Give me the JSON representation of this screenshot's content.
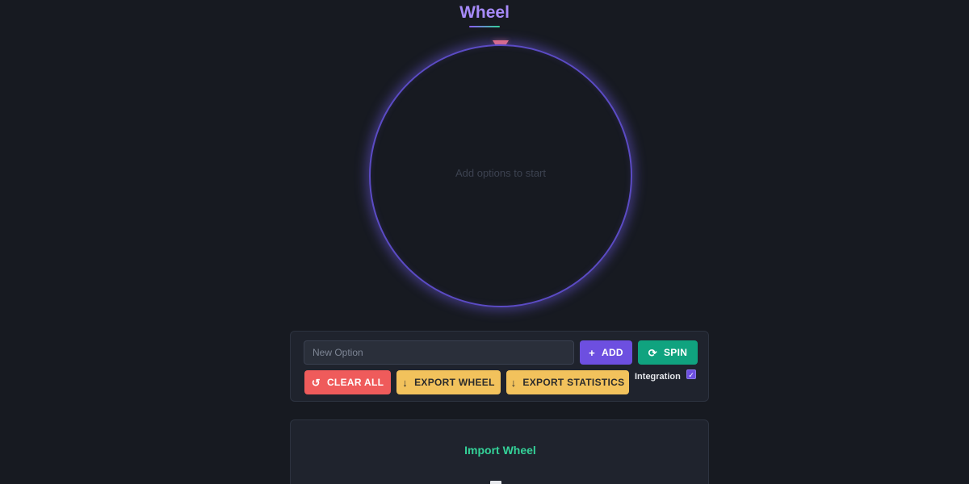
{
  "header": {
    "title": "Wheel"
  },
  "wheel": {
    "empty_text": "Add options to start",
    "options": []
  },
  "controls": {
    "option_input": {
      "value": "",
      "placeholder": "New Option"
    },
    "add_label": "ADD",
    "add_icon": "+",
    "spin_label": "SPIN",
    "spin_icon": "⟳",
    "clear_all_label": "CLEAR ALL",
    "clear_all_icon": "↺",
    "export_wheel_label": "EXPORT WHEEL",
    "export_wheel_icon": "↓",
    "export_statistics_label": "EXPORT STATISTICS",
    "export_statistics_icon": "↓",
    "integration_label": "Integration",
    "integration_checked": true,
    "integration_check_glyph": "✓"
  },
  "import": {
    "title": "Import Wheel"
  },
  "colors": {
    "background": "#171a21",
    "accent_purple": "#6d4fe0",
    "accent_green": "#10a37f",
    "danger_red": "#ef5b5b",
    "warning_yellow": "#f2c25c",
    "title_purple": "#a78bfa",
    "import_title_green": "#34d399",
    "pointer_red": "#f87171"
  }
}
